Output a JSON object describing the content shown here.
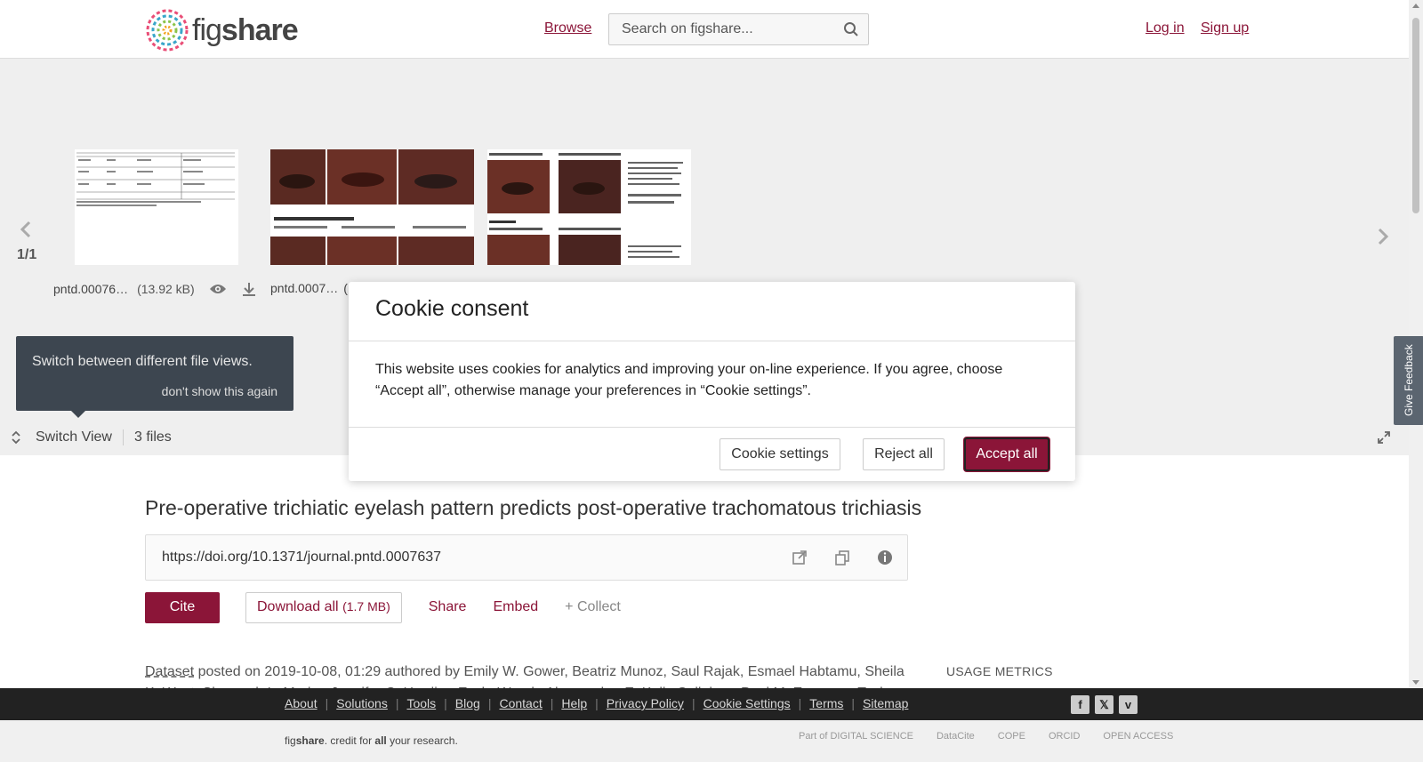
{
  "header": {
    "logo_text_a": "fig",
    "logo_text_b": "share",
    "browse": "Browse",
    "search_placeholder": "Search on figshare...",
    "login": "Log in",
    "signup": "Sign up"
  },
  "viewer": {
    "pager": "1/1",
    "files": [
      {
        "name": "pntd.00076…",
        "size": "(13.92 kB)"
      },
      {
        "name": "pntd.0007…",
        "size": "("
      }
    ],
    "tooltip_text": "Switch between different file views.",
    "tooltip_dismiss": "don't show this again",
    "switch_view": "Switch View",
    "files_count": "3 files",
    "feedback": "Give Feedback"
  },
  "article": {
    "title": "Pre-operative trichiatic eyelash pattern predicts post-operative trachomatous trichiasis",
    "doi": "https://doi.org/10.1371/journal.pntd.0007637",
    "cite": "Cite",
    "download_all": "Download all",
    "download_size": "(1.7 MB)",
    "share": "Share",
    "embed": "Embed",
    "collect": "+ Collect",
    "meta_type": "Dataset",
    "meta_rest": " posted on 2019-10-08, 01:29 authored by Emily W. Gower, Beatriz Munoz, Saul Rajak, Esmael Habtamu, Sheila K. West, Shannath L. Merbs, Jennifer C. Harding-Esch, Wondu Alemayehu, E. Kelly Callahan, Paul M. Emerson, Tesh…",
    "usage_metrics": "USAGE METRICS"
  },
  "footer": {
    "links": [
      "About",
      "Solutions",
      "Tools",
      "Blog",
      "Contact",
      "Help",
      "Privacy Policy",
      "Cookie Settings",
      "Terms",
      "Sitemap"
    ],
    "tagline_a": "fig",
    "tagline_b": "share",
    "tagline_c": ". credit for ",
    "tagline_d": "all",
    "tagline_e": " your research.",
    "partners": [
      "Part of DIGITAL SCIENCE",
      "DataCite",
      "COPE",
      "ORCID",
      "OPEN ACCESS"
    ]
  },
  "cookie": {
    "title": "Cookie consent",
    "body": "This website uses cookies for analytics and improving your on-line experience. If you agree, choose “Accept all”, otherwise manage your preferences in “Cookie settings”.",
    "settings": "Cookie settings",
    "reject": "Reject all",
    "accept": "Accept all"
  },
  "colors": {
    "brand": "#8b1538",
    "footer_dark": "#222222",
    "tooltip_bg": "#3d4650"
  }
}
